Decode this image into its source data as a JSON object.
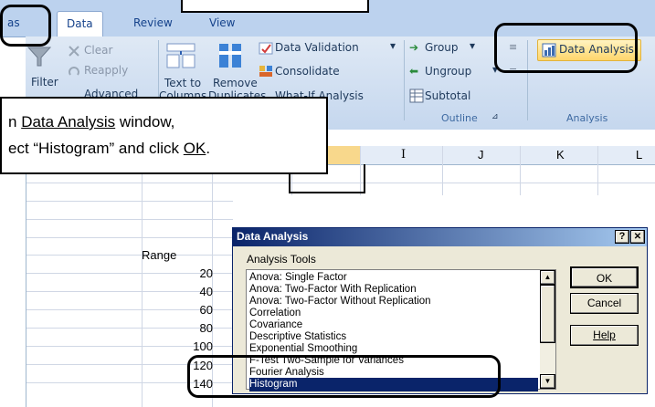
{
  "tabs": [
    {
      "label": "as"
    },
    {
      "label": "Data"
    },
    {
      "label": "Review"
    },
    {
      "label": "View"
    }
  ],
  "ribbon": {
    "sort_filter": {
      "clear": "Clear",
      "reapply": "Reapply",
      "filter": "Filter",
      "advanced": "Advanced"
    },
    "data_tools": {
      "text_to": "Text to",
      "columns": "Columns",
      "remove": "Remove",
      "duplicates": "Duplicates",
      "data_validation": "Data Validation",
      "consolidate": "Consolidate",
      "what_if": "What-If Analysis"
    },
    "outline": {
      "group": "Group",
      "ungroup": "Ungroup",
      "subtotal": "Subtotal",
      "label": "Outline"
    },
    "analysis": {
      "data_analysis": "Data Analysis",
      "label": "Analysis"
    }
  },
  "callout": {
    "line1_prefix": "n ",
    "line1_link": "Data Analysis",
    "line1_suffix": " window,",
    "line2_prefix": "ect “Histogram” and click ",
    "line2_link": "OK",
    "line2_suffix": "."
  },
  "sheet": {
    "col_headers": [
      "I",
      "J",
      "K",
      "L"
    ],
    "range_header": "Range",
    "range_values": [
      "20",
      "40",
      "60",
      "80",
      "100",
      "120",
      "140"
    ]
  },
  "dialog": {
    "title": "Data Analysis",
    "help_glyph": "?",
    "close_glyph": "✕",
    "tools_label": "Analysis Tools",
    "ok": "OK",
    "cancel": "Cancel",
    "help": "Help",
    "items": [
      "Anova: Single Factor",
      "Anova: Two-Factor With Replication",
      "Anova: Two-Factor Without Replication",
      "Correlation",
      "Covariance",
      "Descriptive Statistics",
      "Exponential Smoothing",
      "F-Test Two-Sample for Variances",
      "Fourier Analysis",
      "Histogram"
    ],
    "selected": "Histogram"
  }
}
